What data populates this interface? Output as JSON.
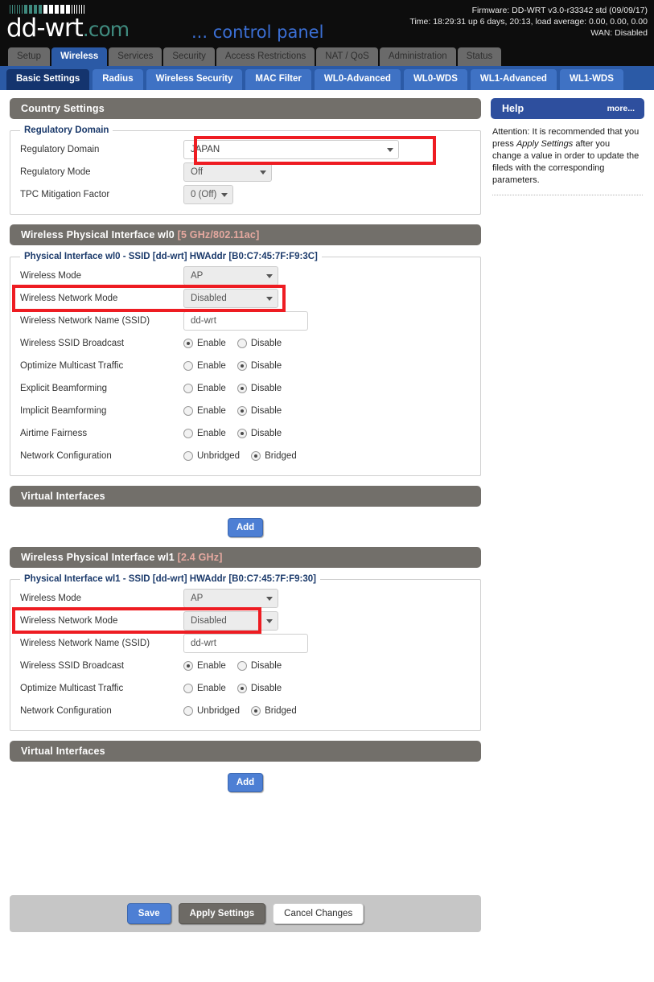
{
  "header": {
    "logo_main": "dd-wrt",
    "logo_suffix": ".com",
    "logo_tagline": "... control panel",
    "firmware": "Firmware: DD-WRT v3.0-r33342 std (09/09/17)",
    "time": "Time: 18:29:31 up 6 days, 20:13, load average: 0.00, 0.00, 0.00",
    "wan": "WAN: Disabled"
  },
  "main_tabs": [
    {
      "label": "Setup",
      "active": false
    },
    {
      "label": "Wireless",
      "active": true
    },
    {
      "label": "Services",
      "active": false
    },
    {
      "label": "Security",
      "active": false
    },
    {
      "label": "Access Restrictions",
      "active": false
    },
    {
      "label": "NAT / QoS",
      "active": false
    },
    {
      "label": "Administration",
      "active": false
    },
    {
      "label": "Status",
      "active": false
    }
  ],
  "sub_tabs": [
    {
      "label": "Basic Settings",
      "active": true
    },
    {
      "label": "Radius",
      "active": false
    },
    {
      "label": "Wireless Security",
      "active": false
    },
    {
      "label": "MAC Filter",
      "active": false
    },
    {
      "label": "WL0-Advanced",
      "active": false
    },
    {
      "label": "WL0-WDS",
      "active": false
    },
    {
      "label": "WL1-Advanced",
      "active": false
    },
    {
      "label": "WL1-WDS",
      "active": false
    }
  ],
  "country_settings": {
    "section_title": "Country Settings",
    "legend": "Regulatory Domain",
    "rows": {
      "regulatory_domain_label": "Regulatory Domain",
      "regulatory_domain_value": "JAPAN",
      "regulatory_mode_label": "Regulatory Mode",
      "regulatory_mode_value": "Off",
      "tpc_label": "TPC Mitigation Factor",
      "tpc_value": "0 (Off)"
    }
  },
  "wl0": {
    "section_title": "Wireless Physical Interface wl0 ",
    "section_band": "[5 GHz/802.11ac]",
    "legend": "Physical Interface wl0 - SSID [dd-wrt] HWAddr [B0:C7:45:7F:F9:3C]",
    "wireless_mode_label": "Wireless Mode",
    "wireless_mode_value": "AP",
    "network_mode_label": "Wireless Network Mode",
    "network_mode_value": "Disabled",
    "ssid_label": "Wireless Network Name (SSID)",
    "ssid_value": "dd-wrt",
    "ssid_broadcast_label": "Wireless SSID Broadcast",
    "ssid_broadcast_value": "Enable",
    "multicast_label": "Optimize Multicast Traffic",
    "multicast_value": "Disable",
    "explicit_bf_label": "Explicit Beamforming",
    "explicit_bf_value": "Disable",
    "implicit_bf_label": "Implicit Beamforming",
    "implicit_bf_value": "Disable",
    "airtime_label": "Airtime Fairness",
    "airtime_value": "Disable",
    "netconf_label": "Network Configuration",
    "netconf_value": "Bridged",
    "enable_label": "Enable",
    "disable_label": "Disable",
    "unbridged_label": "Unbridged",
    "bridged_label": "Bridged"
  },
  "wl1": {
    "section_title": "Wireless Physical Interface wl1 ",
    "section_band": "[2.4 GHz]",
    "legend": "Physical Interface wl1 - SSID [dd-wrt] HWAddr [B0:C7:45:7F:F9:30]",
    "wireless_mode_label": "Wireless Mode",
    "wireless_mode_value": "AP",
    "network_mode_label": "Wireless Network Mode",
    "network_mode_value": "Disabled",
    "ssid_label": "Wireless Network Name (SSID)",
    "ssid_value": "dd-wrt",
    "ssid_broadcast_label": "Wireless SSID Broadcast",
    "ssid_broadcast_value": "Enable",
    "multicast_label": "Optimize Multicast Traffic",
    "multicast_value": "Disable",
    "netconf_label": "Network Configuration",
    "netconf_value": "Bridged",
    "enable_label": "Enable",
    "disable_label": "Disable",
    "unbridged_label": "Unbridged",
    "bridged_label": "Bridged"
  },
  "virtual_interfaces": {
    "section_title": "Virtual Interfaces",
    "add_label": "Add"
  },
  "footer": {
    "save_label": "Save",
    "apply_label": "Apply Settings",
    "cancel_label": "Cancel Changes"
  },
  "help": {
    "title": "Help",
    "more": "more...",
    "text_part1": "Attention: It is recommended that you press ",
    "text_em": "Apply Settings",
    "text_part2": " after you change a value in order to update the fileds with the corresponding parameters."
  },
  "colors": {
    "accent_blue": "#2b5aa6",
    "subtab_blue": "#3f72c4",
    "subtab_active": "#14346e",
    "section_gray": "#726f6a",
    "annotation_red": "#ee1c22",
    "help_blue": "#2e4f9e",
    "logo_teal": "#3f8a7e"
  }
}
